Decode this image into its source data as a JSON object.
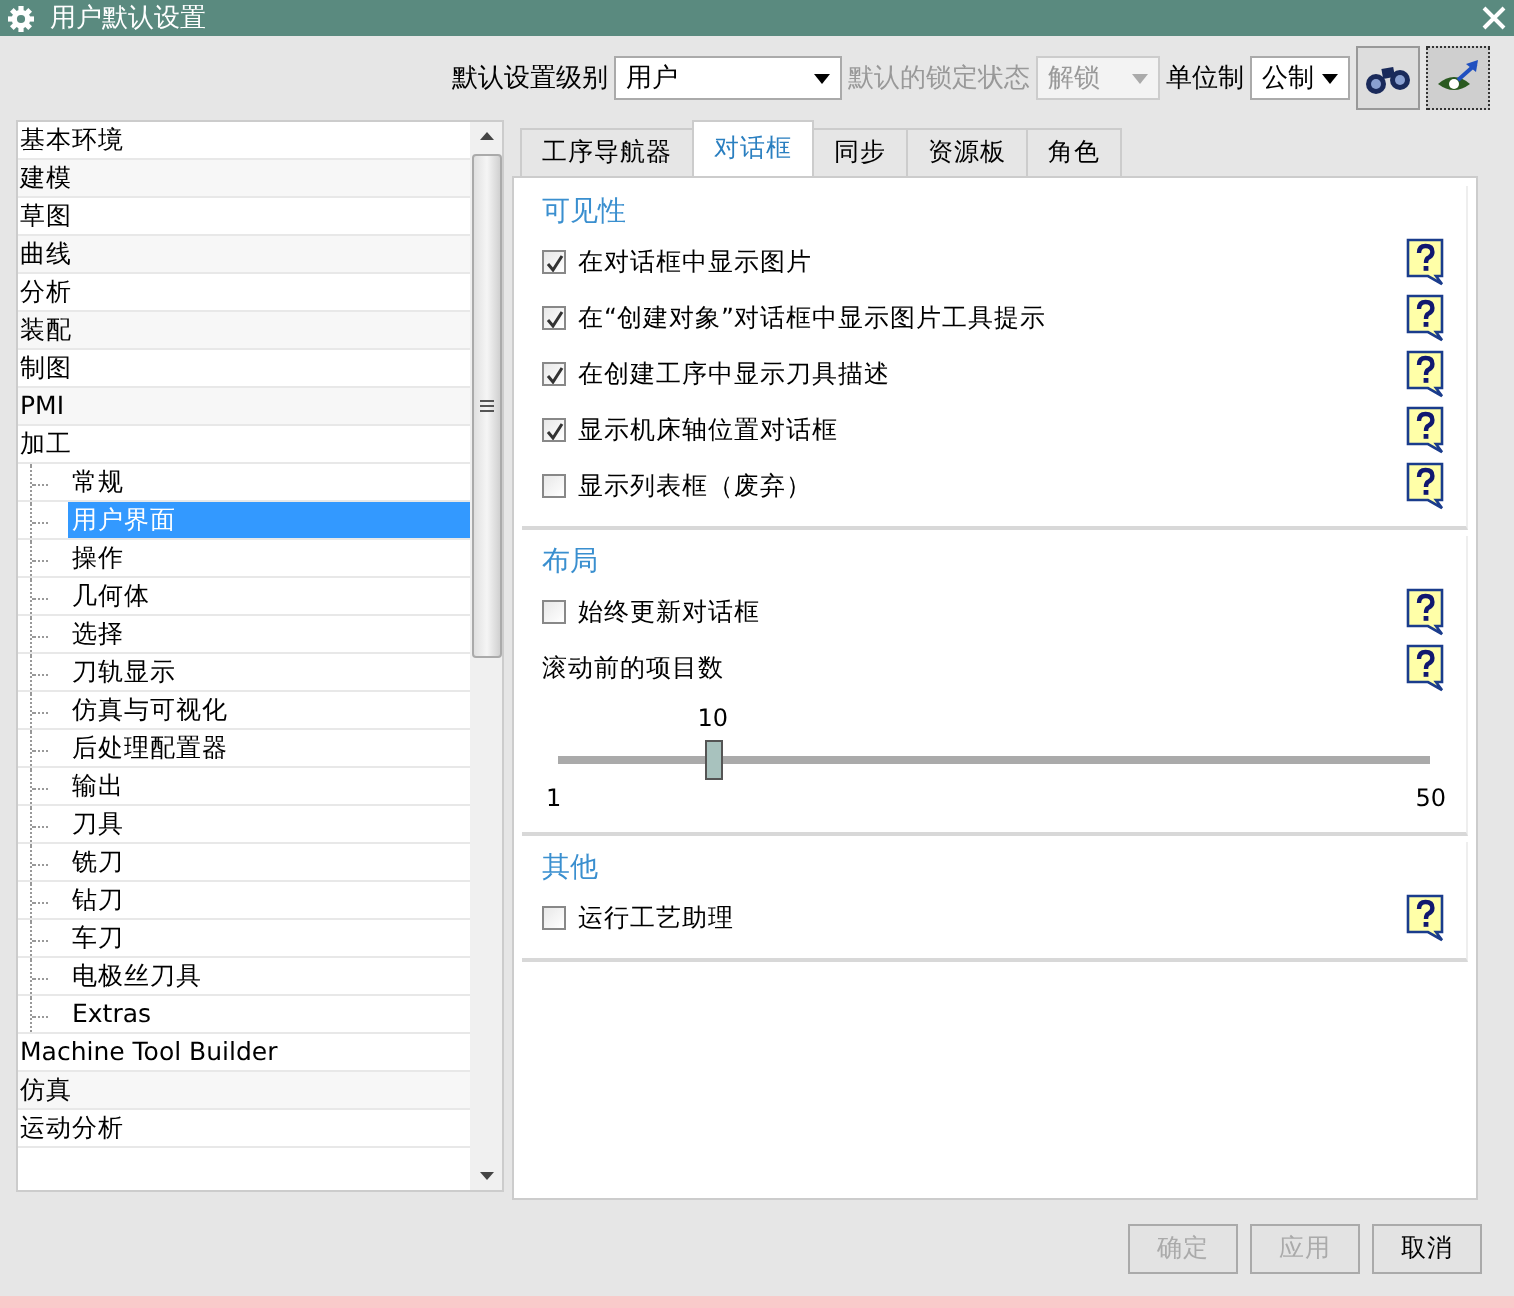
{
  "window": {
    "title": "用户默认设置"
  },
  "toolbar": {
    "level_label": "默认设置级别",
    "level_value": "用户",
    "lock_label": "默认的锁定状态",
    "lock_value": "解锁",
    "lock_disabled": true,
    "unit_label": "单位制",
    "unit_value": "公制"
  },
  "tree": [
    {
      "label": "基本环境",
      "selected": false
    },
    {
      "label": "建模",
      "selected": false
    },
    {
      "label": "草图",
      "selected": false
    },
    {
      "label": "曲线",
      "selected": false
    },
    {
      "label": "分析",
      "selected": false
    },
    {
      "label": "装配",
      "selected": false
    },
    {
      "label": "制图",
      "selected": false
    },
    {
      "label": "PMI",
      "selected": false
    },
    {
      "label": "加工",
      "selected": false,
      "children": [
        {
          "label": "常规",
          "selected": false
        },
        {
          "label": "用户界面",
          "selected": true
        },
        {
          "label": "操作",
          "selected": false
        },
        {
          "label": "几何体",
          "selected": false
        },
        {
          "label": "选择",
          "selected": false
        },
        {
          "label": "刀轨显示",
          "selected": false
        },
        {
          "label": "仿真与可视化",
          "selected": false
        },
        {
          "label": "后处理配置器",
          "selected": false
        },
        {
          "label": "输出",
          "selected": false
        },
        {
          "label": "刀具",
          "selected": false
        },
        {
          "label": "铣刀",
          "selected": false
        },
        {
          "label": "钻刀",
          "selected": false
        },
        {
          "label": "车刀",
          "selected": false
        },
        {
          "label": "电极丝刀具",
          "selected": false
        },
        {
          "label": "Extras",
          "selected": false
        }
      ]
    },
    {
      "label": "Machine Tool Builder",
      "selected": false
    },
    {
      "label": "仿真",
      "selected": false
    },
    {
      "label": "运动分析",
      "selected": false
    }
  ],
  "tabs": [
    {
      "label": "工序导航器",
      "selected": false
    },
    {
      "label": "对话框",
      "selected": true
    },
    {
      "label": "同步",
      "selected": false
    },
    {
      "label": "资源板",
      "selected": false
    },
    {
      "label": "角色",
      "selected": false
    }
  ],
  "sections": [
    {
      "title": "可见性",
      "items": [
        {
          "kind": "checkbox",
          "label": "在对话框中显示图片",
          "checked": true
        },
        {
          "kind": "checkbox",
          "label": "在“创建对象”对话框中显示图片工具提示",
          "checked": true
        },
        {
          "kind": "checkbox",
          "label": "在创建工序中显示刀具描述",
          "checked": true
        },
        {
          "kind": "checkbox",
          "label": "显示机床轴位置对话框",
          "checked": true
        },
        {
          "kind": "checkbox",
          "label": "显示列表框（废弃）",
          "checked": false
        }
      ]
    },
    {
      "title": "布局",
      "items": [
        {
          "kind": "checkbox",
          "label": "始终更新对话框",
          "checked": false
        },
        {
          "kind": "slider",
          "label": "滚动前的项目数",
          "value": "10",
          "min": "1",
          "max": "50",
          "level": 0.18
        }
      ]
    },
    {
      "title": "其他",
      "items": [
        {
          "kind": "checkbox",
          "label": "运行工艺助理",
          "checked": false
        }
      ]
    }
  ],
  "buttons": [
    {
      "label": "确定",
      "disabled": true
    },
    {
      "label": "应用",
      "disabled": true
    },
    {
      "label": "取消",
      "disabled": false
    }
  ]
}
